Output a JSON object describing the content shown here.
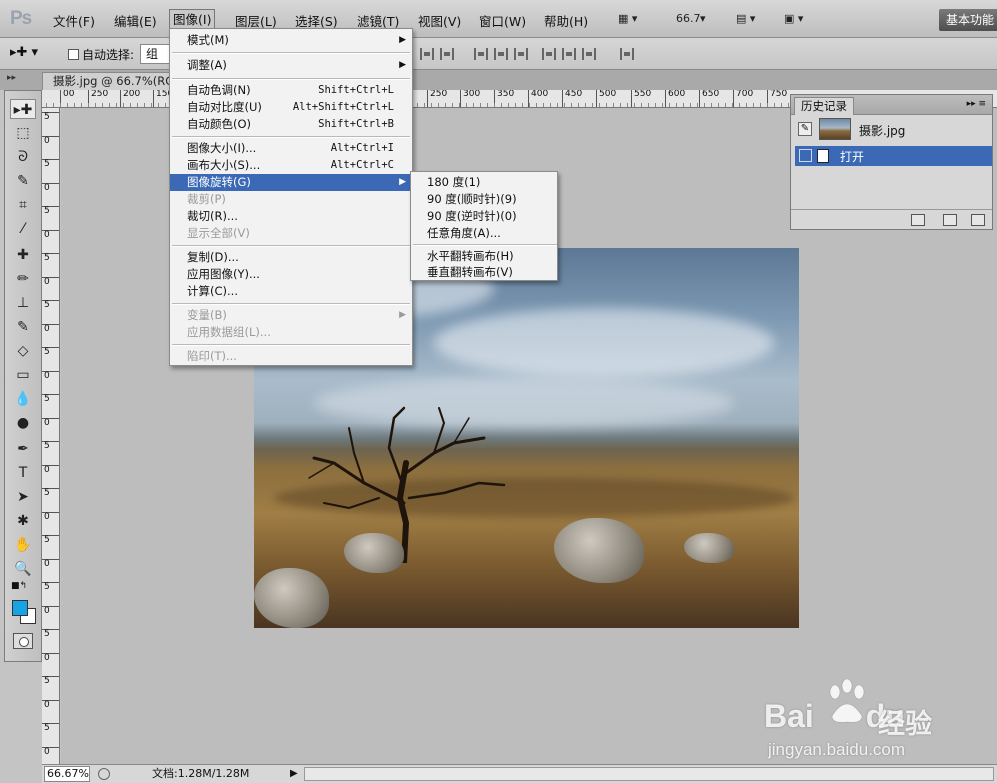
{
  "app": {
    "logo": "Ps",
    "zoom_display": "66.7"
  },
  "menubar": {
    "items": [
      "文件(F)",
      "编辑(E)",
      "图像(I)",
      "图层(L)",
      "选择(S)",
      "滤镜(T)",
      "视图(V)",
      "窗口(W)",
      "帮助(H)"
    ],
    "active_index": 2,
    "workspace_label": "基本功能"
  },
  "options": {
    "auto_select_label": "自动选择:",
    "auto_select_value": "组"
  },
  "document": {
    "tab_title": "摄影.jpg @ 66.7%(RGB/8)"
  },
  "ruler": {
    "h_labels": [
      "00",
      "250",
      "200",
      "150",
      "250",
      "300",
      "350",
      "400",
      "450",
      "500",
      "550",
      "600",
      "650",
      "700",
      "750"
    ],
    "v_labels": [
      "5",
      "0",
      "5",
      "0",
      "5",
      "0",
      "5",
      "0",
      "5",
      "0",
      "5",
      "0",
      "5",
      "0",
      "5",
      "0",
      "5",
      "0",
      "5",
      "0",
      "5",
      "0",
      "5",
      "0",
      "5",
      "0",
      "5",
      "0"
    ]
  },
  "image_menu": {
    "items": [
      {
        "label": "模式(M)",
        "shortcut": "",
        "submenu": true,
        "disabled": false
      },
      {
        "label": "调整(A)",
        "shortcut": "",
        "submenu": true,
        "disabled": false
      },
      {
        "label": "自动色调(N)",
        "shortcut": "Shift+Ctrl+L",
        "submenu": false,
        "disabled": false
      },
      {
        "label": "自动对比度(U)",
        "shortcut": "Alt+Shift+Ctrl+L",
        "submenu": false,
        "disabled": false
      },
      {
        "label": "自动颜色(O)",
        "shortcut": "Shift+Ctrl+B",
        "submenu": false,
        "disabled": false
      },
      {
        "label": "图像大小(I)...",
        "shortcut": "Alt+Ctrl+I",
        "submenu": false,
        "disabled": false
      },
      {
        "label": "画布大小(S)...",
        "shortcut": "Alt+Ctrl+C",
        "submenu": false,
        "disabled": false
      },
      {
        "label": "图像旋转(G)",
        "shortcut": "",
        "submenu": true,
        "disabled": false
      },
      {
        "label": "裁剪(P)",
        "shortcut": "",
        "submenu": false,
        "disabled": true
      },
      {
        "label": "裁切(R)...",
        "shortcut": "",
        "submenu": false,
        "disabled": false
      },
      {
        "label": "显示全部(V)",
        "shortcut": "",
        "submenu": false,
        "disabled": true
      },
      {
        "label": "复制(D)...",
        "shortcut": "",
        "submenu": false,
        "disabled": false
      },
      {
        "label": "应用图像(Y)...",
        "shortcut": "",
        "submenu": false,
        "disabled": false
      },
      {
        "label": "计算(C)...",
        "shortcut": "",
        "submenu": false,
        "disabled": false
      },
      {
        "label": "变量(B)",
        "shortcut": "",
        "submenu": true,
        "disabled": true
      },
      {
        "label": "应用数据组(L)...",
        "shortcut": "",
        "submenu": false,
        "disabled": true
      },
      {
        "label": "陷印(T)...",
        "shortcut": "",
        "submenu": false,
        "disabled": true
      }
    ],
    "highlight_index": 7
  },
  "rotate_submenu": {
    "items": [
      "180 度(1)",
      "90 度(顺时针)(9)",
      "90 度(逆时针)(0)",
      "任意角度(A)...",
      "水平翻转画布(H)",
      "垂直翻转画布(V)"
    ]
  },
  "history": {
    "tab_label": "历史记录",
    "snapshot_label": "摄影.jpg",
    "step_label": "打开"
  },
  "status": {
    "zoom": "66.67%",
    "doc_size": "文档:1.28M/1.28M"
  },
  "colors": {
    "foreground": "#16a4e5",
    "background": "#ffffff",
    "highlight": "#3b69b5"
  },
  "watermark": {
    "logo": "Bai",
    "logo_tail": "du",
    "brand_cn": "经验",
    "url": "jingyan.baidu.com"
  }
}
